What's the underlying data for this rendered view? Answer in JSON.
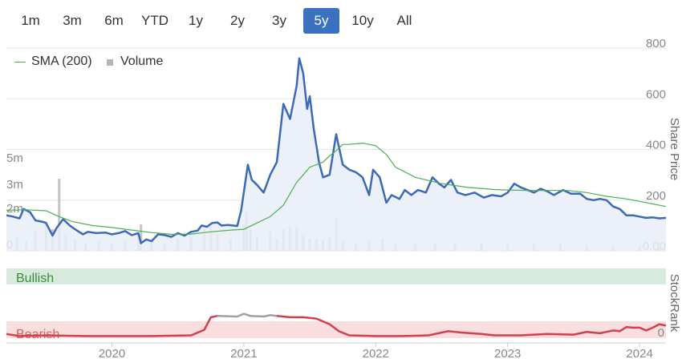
{
  "range_buttons": {
    "items": [
      "1m",
      "3m",
      "6m",
      "YTD",
      "1y",
      "2y",
      "3y",
      "5y",
      "10y",
      "All"
    ],
    "active": "5y"
  },
  "legend": {
    "sma_label": "SMA (200)",
    "volume_label": "Volume"
  },
  "colors": {
    "price_line": "#3d6ab5",
    "price_fill": "#e9edf7",
    "sma_line": "#4caf50",
    "volume_bar": "#c4c4c4",
    "bullish_band": "#d7ebdc",
    "bearish_band": "#f8dede",
    "bullish_text": "#3c8c3c",
    "bearish_text": "#d96060",
    "rank_red": "#d0414e",
    "rank_grey": "#a0a0a0",
    "grid": "#e6e6e6",
    "axis_text": "#888888"
  },
  "chart_data": [
    {
      "type": "line",
      "x_label": "",
      "y_label": "Share Price",
      "y_ticks": [
        "0.00",
        "200",
        "400",
        "600",
        "800"
      ],
      "volume_ticks": [
        "0",
        "2m",
        "3m",
        "5m"
      ],
      "x_ticks": [
        "2020",
        "2021",
        "2022",
        "2023",
        "2024"
      ],
      "ylim": [
        0,
        800
      ],
      "x_range": [
        2019.2,
        2024.2
      ],
      "series": [
        {
          "name": "Share Price",
          "points": [
            [
              2019.2,
              140
            ],
            [
              2019.25,
              135
            ],
            [
              2019.3,
              128
            ],
            [
              2019.33,
              165
            ],
            [
              2019.38,
              152
            ],
            [
              2019.42,
              120
            ],
            [
              2019.47,
              115
            ],
            [
              2019.5,
              110
            ],
            [
              2019.55,
              60
            ],
            [
              2019.58,
              90
            ],
            [
              2019.63,
              125
            ],
            [
              2019.68,
              100
            ],
            [
              2019.72,
              85
            ],
            [
              2019.78,
              65
            ],
            [
              2019.82,
              75
            ],
            [
              2019.88,
              70
            ],
            [
              2019.95,
              72
            ],
            [
              2020.0,
              65
            ],
            [
              2020.05,
              70
            ],
            [
              2020.1,
              78
            ],
            [
              2020.15,
              62
            ],
            [
              2020.2,
              70
            ],
            [
              2020.22,
              30
            ],
            [
              2020.26,
              45
            ],
            [
              2020.3,
              38
            ],
            [
              2020.35,
              65
            ],
            [
              2020.4,
              62
            ],
            [
              2020.45,
              55
            ],
            [
              2020.5,
              70
            ],
            [
              2020.55,
              60
            ],
            [
              2020.6,
              75
            ],
            [
              2020.65,
              80
            ],
            [
              2020.68,
              100
            ],
            [
              2020.72,
              95
            ],
            [
              2020.76,
              110
            ],
            [
              2020.8,
              112
            ],
            [
              2020.83,
              100
            ],
            [
              2020.88,
              102
            ],
            [
              2020.95,
              98
            ],
            [
              2020.98,
              160
            ],
            [
              2021.03,
              340
            ],
            [
              2021.06,
              280
            ],
            [
              2021.1,
              260
            ],
            [
              2021.15,
              230
            ],
            [
              2021.2,
              300
            ],
            [
              2021.25,
              350
            ],
            [
              2021.3,
              580
            ],
            [
              2021.35,
              520
            ],
            [
              2021.4,
              650
            ],
            [
              2021.42,
              760
            ],
            [
              2021.45,
              700
            ],
            [
              2021.48,
              560
            ],
            [
              2021.5,
              610
            ],
            [
              2021.53,
              480
            ],
            [
              2021.57,
              350
            ],
            [
              2021.6,
              290
            ],
            [
              2021.65,
              300
            ],
            [
              2021.7,
              460
            ],
            [
              2021.75,
              340
            ],
            [
              2021.8,
              320
            ],
            [
              2021.85,
              310
            ],
            [
              2021.9,
              290
            ],
            [
              2021.95,
              220
            ],
            [
              2021.98,
              320
            ],
            [
              2022.03,
              290
            ],
            [
              2022.08,
              190
            ],
            [
              2022.12,
              220
            ],
            [
              2022.18,
              205
            ],
            [
              2022.22,
              240
            ],
            [
              2022.27,
              220
            ],
            [
              2022.32,
              240
            ],
            [
              2022.38,
              230
            ],
            [
              2022.43,
              290
            ],
            [
              2022.48,
              265
            ],
            [
              2022.52,
              250
            ],
            [
              2022.57,
              280
            ],
            [
              2022.62,
              230
            ],
            [
              2022.68,
              220
            ],
            [
              2022.75,
              230
            ],
            [
              2022.82,
              210
            ],
            [
              2022.88,
              220
            ],
            [
              2022.95,
              215
            ],
            [
              2023.0,
              230
            ],
            [
              2023.05,
              265
            ],
            [
              2023.1,
              250
            ],
            [
              2023.15,
              240
            ],
            [
              2023.2,
              230
            ],
            [
              2023.25,
              245
            ],
            [
              2023.3,
              235
            ],
            [
              2023.35,
              220
            ],
            [
              2023.42,
              240
            ],
            [
              2023.48,
              225
            ],
            [
              2023.55,
              225
            ],
            [
              2023.6,
              205
            ],
            [
              2023.65,
              200
            ],
            [
              2023.7,
              205
            ],
            [
              2023.75,
              200
            ],
            [
              2023.8,
              175
            ],
            [
              2023.85,
              165
            ],
            [
              2023.9,
              140
            ],
            [
              2023.95,
              140
            ],
            [
              2024.0,
              135
            ],
            [
              2024.05,
              130
            ],
            [
              2024.1,
              132
            ],
            [
              2024.15,
              128
            ],
            [
              2024.2,
              130
            ]
          ]
        },
        {
          "name": "SMA (200)",
          "points": [
            [
              2019.2,
              160
            ],
            [
              2019.35,
              162
            ],
            [
              2019.5,
              158
            ],
            [
              2019.6,
              135
            ],
            [
              2019.7,
              115
            ],
            [
              2019.85,
              100
            ],
            [
              2020.0,
              92
            ],
            [
              2020.15,
              82
            ],
            [
              2020.3,
              72
            ],
            [
              2020.45,
              65
            ],
            [
              2020.6,
              66
            ],
            [
              2020.75,
              75
            ],
            [
              2020.9,
              82
            ],
            [
              2021.0,
              85
            ],
            [
              2021.1,
              110
            ],
            [
              2021.2,
              135
            ],
            [
              2021.3,
              180
            ],
            [
              2021.4,
              270
            ],
            [
              2021.5,
              330
            ],
            [
              2021.6,
              350
            ],
            [
              2021.65,
              375
            ],
            [
              2021.7,
              395
            ],
            [
              2021.75,
              420
            ],
            [
              2021.8,
              420
            ],
            [
              2021.9,
              425
            ],
            [
              2022.0,
              415
            ],
            [
              2022.08,
              380
            ],
            [
              2022.15,
              330
            ],
            [
              2022.3,
              290
            ],
            [
              2022.5,
              265
            ],
            [
              2022.7,
              250
            ],
            [
              2022.9,
              242
            ],
            [
              2023.0,
              240
            ],
            [
              2023.15,
              238
            ],
            [
              2023.3,
              238
            ],
            [
              2023.45,
              238
            ],
            [
              2023.6,
              230
            ],
            [
              2023.75,
              215
            ],
            [
              2023.9,
              205
            ],
            [
              2024.0,
              195
            ],
            [
              2024.1,
              185
            ],
            [
              2024.2,
              175
            ]
          ]
        }
      ],
      "volume_mm": [
        [
          2019.28,
          0.6
        ],
        [
          2019.35,
          0.4
        ],
        [
          2019.42,
          0.8
        ],
        [
          2019.5,
          1.2
        ],
        [
          2019.55,
          0.9
        ],
        [
          2019.6,
          3.0
        ],
        [
          2019.65,
          0.7
        ],
        [
          2019.72,
          0.5
        ],
        [
          2019.8,
          0.3
        ],
        [
          2019.9,
          0.4
        ],
        [
          2020.0,
          0.3
        ],
        [
          2020.1,
          0.4
        ],
        [
          2020.2,
          0.7
        ],
        [
          2020.22,
          1.1
        ],
        [
          2020.3,
          0.4
        ],
        [
          2020.4,
          0.3
        ],
        [
          2020.5,
          0.5
        ],
        [
          2020.6,
          0.6
        ],
        [
          2020.7,
          0.9
        ],
        [
          2020.75,
          1.0
        ],
        [
          2020.8,
          0.7
        ],
        [
          2020.9,
          0.5
        ],
        [
          2021.0,
          1.1
        ],
        [
          2021.02,
          1.6
        ],
        [
          2021.05,
          0.9
        ],
        [
          2021.1,
          0.6
        ],
        [
          2021.2,
          0.8
        ],
        [
          2021.25,
          0.5
        ],
        [
          2021.3,
          0.9
        ],
        [
          2021.35,
          1.0
        ],
        [
          2021.4,
          1.0
        ],
        [
          2021.45,
          0.7
        ],
        [
          2021.5,
          0.5
        ],
        [
          2021.55,
          0.5
        ],
        [
          2021.6,
          0.4
        ],
        [
          2021.65,
          0.6
        ],
        [
          2021.7,
          1.4
        ],
        [
          2021.75,
          0.4
        ],
        [
          2021.85,
          0.3
        ],
        [
          2021.95,
          0.4
        ],
        [
          2022.05,
          0.5
        ],
        [
          2022.15,
          0.3
        ],
        [
          2022.3,
          0.3
        ],
        [
          2022.45,
          0.3
        ],
        [
          2022.6,
          0.3
        ],
        [
          2022.8,
          0.3
        ],
        [
          2023.0,
          0.3
        ],
        [
          2023.2,
          0.3
        ],
        [
          2023.4,
          0.3
        ],
        [
          2023.6,
          0.2
        ],
        [
          2023.8,
          0.2
        ],
        [
          2024.0,
          0.2
        ],
        [
          2024.15,
          0.2
        ]
      ]
    },
    {
      "type": "area",
      "y_label": "StockRank",
      "bands": [
        "Bullish",
        "Bearish"
      ],
      "y_ticks": [
        "0"
      ],
      "ylim": [
        0,
        100
      ],
      "series": [
        {
          "name": "StockRank",
          "points": [
            [
              2019.2,
              6
            ],
            [
              2019.3,
              3
            ],
            [
              2019.5,
              4
            ],
            [
              2019.8,
              3
            ],
            [
              2020.0,
              3
            ],
            [
              2020.3,
              3
            ],
            [
              2020.6,
              4
            ],
            [
              2020.7,
              12
            ],
            [
              2020.75,
              30
            ],
            [
              2020.8,
              32
            ],
            [
              2020.95,
              31
            ],
            [
              2021.0,
              35
            ],
            [
              2021.05,
              32
            ],
            [
              2021.15,
              31
            ],
            [
              2021.2,
              33
            ],
            [
              2021.25,
              32
            ],
            [
              2021.35,
              30
            ],
            [
              2021.45,
              30
            ],
            [
              2021.55,
              28
            ],
            [
              2021.65,
              20
            ],
            [
              2021.72,
              10
            ],
            [
              2021.8,
              4
            ],
            [
              2022.0,
              3
            ],
            [
              2022.2,
              3
            ],
            [
              2022.4,
              4
            ],
            [
              2022.5,
              8
            ],
            [
              2022.55,
              10
            ],
            [
              2022.65,
              8
            ],
            [
              2022.8,
              6
            ],
            [
              2022.9,
              4
            ],
            [
              2023.1,
              4
            ],
            [
              2023.3,
              6
            ],
            [
              2023.5,
              5
            ],
            [
              2023.6,
              9
            ],
            [
              2023.7,
              7
            ],
            [
              2023.8,
              11
            ],
            [
              2023.85,
              10
            ],
            [
              2023.9,
              16
            ],
            [
              2023.95,
              15
            ],
            [
              2024.0,
              15
            ],
            [
              2024.05,
              11
            ],
            [
              2024.1,
              15
            ],
            [
              2024.15,
              20
            ],
            [
              2024.2,
              18
            ]
          ],
          "grey_segment": [
            2020.8,
            2021.25
          ]
        }
      ]
    }
  ]
}
